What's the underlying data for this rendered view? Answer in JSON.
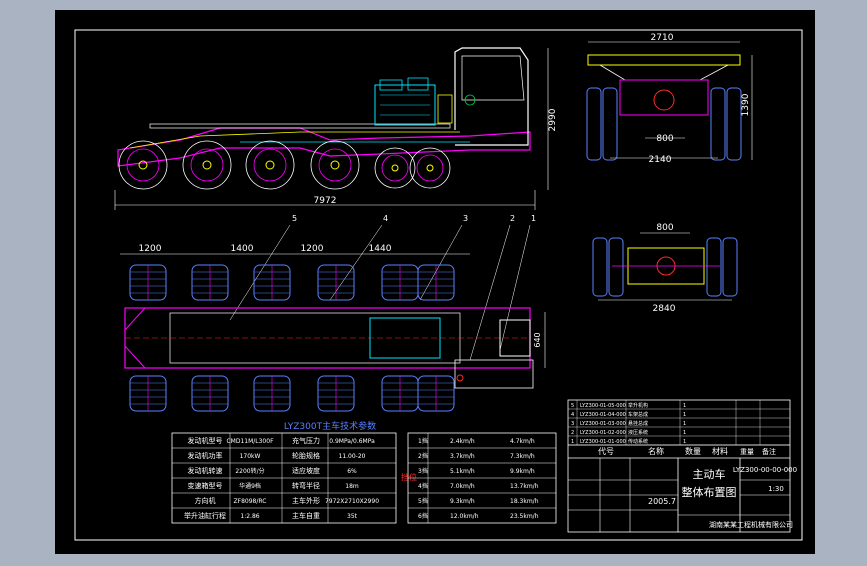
{
  "background": "#a9b3c1",
  "colors": {
    "paper": "#000000",
    "frame": "#ffffff",
    "dim": "#ffffff",
    "frame_body": "#ff00ff",
    "wheel": "#5a7fff",
    "engine": "#00e5ff",
    "accent": "#ffff00",
    "red": "#ff2a2a",
    "green": "#00cc44"
  },
  "dimensions": {
    "side_length": "7972",
    "side_height": "2990",
    "rear_width": "2710",
    "rear_height": "1390",
    "rear_inner": "800",
    "rear_track": "2140",
    "front_inner": "800",
    "front_track": "2840",
    "axle_1": "1200",
    "axle_2": "1400",
    "axle_3": "1200",
    "axle_4": "1440",
    "plan_width": "640"
  },
  "part_callouts": [
    "5",
    "4",
    "3",
    "2",
    "1"
  ],
  "params": {
    "title": "LYZ300T主车技术参数",
    "rows": [
      [
        "发动机型号",
        "CMD11M/L300F",
        "充气压力",
        "0.9MPa/0.6MPa"
      ],
      [
        "发动机功率",
        "170kW",
        "轮胎规格",
        "11.00-20"
      ],
      [
        "发动机转速",
        "2200转/分",
        "适应坡度",
        "6%"
      ],
      [
        "变速箱型号",
        "华通9档",
        "转弯半径",
        "18m"
      ],
      [
        "方向机",
        "ZF8098/RC",
        "主车外形",
        "7972X2710X2990"
      ],
      [
        "举升油缸行程",
        "1:2.86",
        "主车自重",
        "35t"
      ]
    ],
    "gear_label": "挡位",
    "gears": [
      [
        "1挡",
        "2.4km/h",
        "4.7km/h"
      ],
      [
        "2挡",
        "3.7km/h",
        "7.3km/h"
      ],
      [
        "3挡",
        "5.1km/h",
        "9.9km/h"
      ],
      [
        "4挡",
        "7.0km/h",
        "13.7km/h"
      ],
      [
        "5挡",
        "9.3km/h",
        "18.3km/h"
      ],
      [
        "6挡",
        "12.0km/h",
        "23.5km/h"
      ]
    ]
  },
  "parts_list": [
    [
      "5",
      "LYZ300-01-05-000",
      "举升机构",
      "1"
    ],
    [
      "4",
      "LYZ300-01-04-000",
      "车架总成",
      "1"
    ],
    [
      "3",
      "LYZ300-01-03-000",
      "悬挂总成",
      "1"
    ],
    [
      "2",
      "LYZ300-01-02-000",
      "液压系统",
      "1"
    ],
    [
      "1",
      "LYZ300-01-01-000",
      "传动系统",
      "1"
    ]
  ],
  "title_block": {
    "col_code": "代号",
    "col_name": "名称",
    "col_qty": "数量",
    "col_material": "材料",
    "weight_label": "重量",
    "note_label": "备注",
    "drawing_no": "LYZ300-00-00-000",
    "drawing_title_1": "主动车",
    "drawing_title_2": "整体布置图",
    "date": "2005.7",
    "scale": "1:30",
    "company": "湖南某某工程机械有限公司"
  }
}
